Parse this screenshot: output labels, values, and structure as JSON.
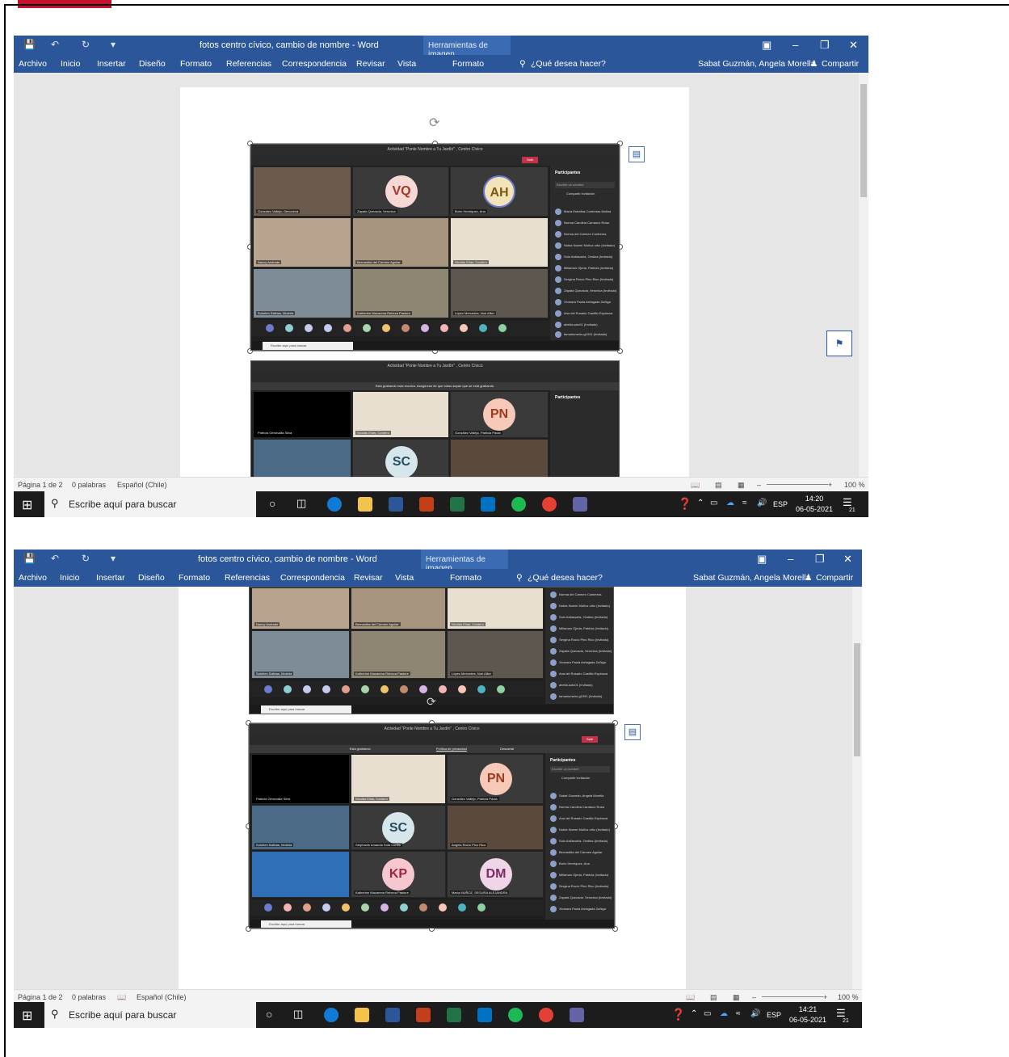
{
  "window": {
    "title": "fotos centro cívico, cambio de nombre - Word",
    "context_tools": "Herramientas de imagen",
    "user": "Sabat Guzmán, Angela Morella",
    "share": "Compartir",
    "tell_me": "¿Qué desea hacer?"
  },
  "ribbon": {
    "tabs": [
      "Archivo",
      "Inicio",
      "Insertar",
      "Diseño",
      "Formato",
      "Referencias",
      "Correspondencia",
      "Revisar",
      "Vista",
      "Formato"
    ]
  },
  "status": {
    "page": "Página 1 de 2",
    "words": "0 palabras",
    "language": "Español (Chile)",
    "zoom": "100 %"
  },
  "taskbar": {
    "search_placeholder": "Escribe aquí para buscar",
    "lang": "ESP",
    "time1": "14:20",
    "time2": "14:21",
    "date": "06-05-2021",
    "notifications": "21"
  },
  "teams": {
    "meeting_title": "Actividad \"Ponle Nombre a Tu Jardín\" , Centro Cívico",
    "leave": "Salir",
    "participants": "Participantes",
    "invite": "Compartir invitación",
    "search_name": "Escribir un nombre",
    "recording": "Está grabando",
    "recording_msg": "Está grabando esta reunión. Asegúrese de que todos sepan que se está grabando.",
    "privacy": "Política de privacidad",
    "dismiss": "Descartar",
    "avatars": {
      "vq": "VQ",
      "ah": "AH",
      "pn": "PN",
      "sc": "SC",
      "kp": "KP",
      "dm": "DM"
    },
    "participant_list": [
      "María Estrellas Contreras Molina",
      "Norma Carolina Carrasco Rosa",
      "Norma del Carmen Contreras",
      "Nubia Noemí Muñoz ortiz (Invitado)",
      "Sulo Astiasuela, Ondina (Invitado)",
      "Millaman Ojeda, Patricia (Invitado)",
      "Sergina Rocío Pino Rico (Invitado)",
      "Zapata Quezada, Veronica (Invitado)",
      "Xiomara Paola Arriagada Zuñiga",
      "Ana del Rosario Castillo Espinoza",
      "abella.soto01 (Invitado)",
      "tamarlumeiro.g1991 (Invitado)"
    ],
    "tile_names": [
      "González Vallejo, Genoveva",
      "Zapata Quezada, Veronica",
      "Burlo Henriquez, Ana",
      "Nancy Andrade",
      "Bernardita del Carmen Aguilar",
      "Nicolás Elías, Cordero",
      "Suhelen Salinas, Moleria",
      "Katherine Macarena Rebeca Pastore",
      "López Mercedes, Noé Allier",
      "Patricia Genovalla Silva",
      "González Vallejo, Patricia Paola",
      "Stephanie Amanda Sota Cortés",
      "Angela Rocío Pino Rico",
      "María MUÑOZ, SEGURA ALEJANDRA"
    ]
  }
}
